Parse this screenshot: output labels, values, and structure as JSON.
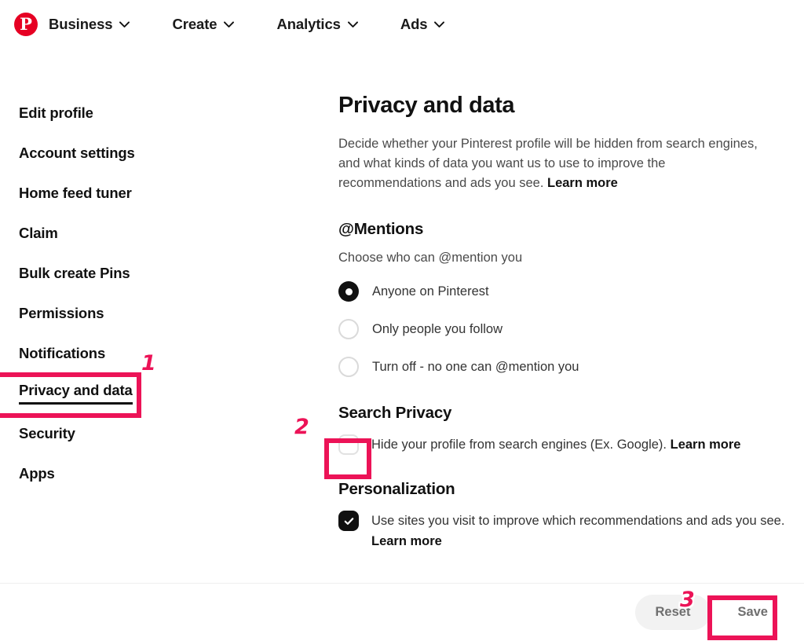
{
  "topnav": {
    "logo_icon": "pinterest-logo-icon",
    "logo_letter": "P",
    "items": [
      {
        "label": "Business",
        "icon": "chevron-down-icon"
      },
      {
        "label": "Create",
        "icon": "chevron-down-icon"
      },
      {
        "label": "Analytics",
        "icon": "chevron-down-icon"
      },
      {
        "label": "Ads",
        "icon": "chevron-down-icon"
      }
    ]
  },
  "sidebar": {
    "items": [
      {
        "label": "Edit profile",
        "active": false
      },
      {
        "label": "Account settings",
        "active": false
      },
      {
        "label": "Home feed tuner",
        "active": false
      },
      {
        "label": "Claim",
        "active": false
      },
      {
        "label": "Bulk create Pins",
        "active": false
      },
      {
        "label": "Permissions",
        "active": false
      },
      {
        "label": "Notifications",
        "active": false
      },
      {
        "label": "Privacy and data",
        "active": true
      },
      {
        "label": "Security",
        "active": false
      },
      {
        "label": "Apps",
        "active": false
      }
    ]
  },
  "main": {
    "title": "Privacy and data",
    "description": "Decide whether your Pinterest profile will be hidden from search engines, and what kinds of data you want us to use to improve the recommendations and ads you see.",
    "description_link": "Learn more",
    "mentions": {
      "title": "@Mentions",
      "subtitle": "Choose who can @mention you",
      "options": [
        {
          "label": "Anyone on Pinterest",
          "selected": true
        },
        {
          "label": "Only people you follow",
          "selected": false
        },
        {
          "label": "Turn off - no one can @mention you",
          "selected": false
        }
      ]
    },
    "search_privacy": {
      "title": "Search Privacy",
      "label": "Hide your profile from search engines (Ex. Google).",
      "link": "Learn more",
      "checked": false
    },
    "personalization": {
      "title": "Personalization",
      "label": "Use sites you visit to improve which recommendations and ads you see.",
      "link": "Learn more",
      "checked": true
    }
  },
  "footer": {
    "reset_label": "Reset",
    "save_label": "Save"
  },
  "annotations": {
    "accent_color": "#ec1357",
    "markers": [
      {
        "number": "1",
        "target": "sidebar-item-privacy-and-data"
      },
      {
        "number": "2",
        "target": "search-privacy-checkbox"
      },
      {
        "number": "3",
        "target": "save-button"
      }
    ]
  }
}
